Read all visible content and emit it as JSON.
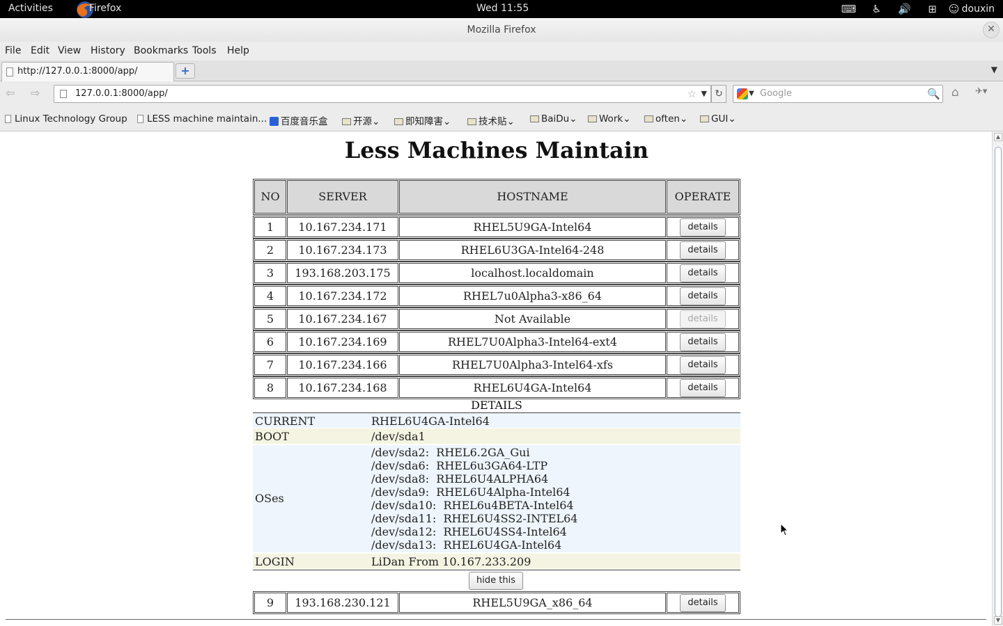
{
  "topbar": {
    "activities": "Activities",
    "app": "Firefox",
    "clock": "Wed 11:55",
    "user": "douxin"
  },
  "window": {
    "title": "Mozilla Firefox"
  },
  "menu": [
    "File",
    "Edit",
    "View",
    "History",
    "Bookmarks",
    "Tools",
    "Help"
  ],
  "tab": {
    "label": "http://127.0.0.1:8000/app/"
  },
  "nav": {
    "url": "127.0.0.1:8000/app/",
    "search_placeholder": "Google"
  },
  "bookmarks": [
    "Linux Technology Group",
    "LESS machine maintain...",
    "百度音乐盒",
    "开源",
    "即知障害",
    "技术贴",
    "BaiDu",
    "Work",
    "often",
    "GUI"
  ],
  "page": {
    "title": "Less Machines Maintain",
    "headers": [
      "NO",
      "SERVER",
      "HOSTNAME",
      "OPERATE"
    ],
    "button_label": "details",
    "rows": [
      {
        "no": "1",
        "server": "10.167.234.171",
        "hostname": "RHEL5U9GA-Intel64",
        "enabled": true
      },
      {
        "no": "2",
        "server": "10.167.234.173",
        "hostname": "RHEL6U3GA-Intel64-248",
        "enabled": true
      },
      {
        "no": "3",
        "server": "193.168.203.175",
        "hostname": "localhost.localdomain",
        "enabled": true
      },
      {
        "no": "4",
        "server": "10.167.234.172",
        "hostname": "RHEL7u0Alpha3-x86_64",
        "enabled": true
      },
      {
        "no": "5",
        "server": "10.167.234.167",
        "hostname": "Not Available",
        "enabled": false
      },
      {
        "no": "6",
        "server": "10.167.234.169",
        "hostname": "RHEL7U0Alpha3-Intel64-ext4",
        "enabled": true
      },
      {
        "no": "7",
        "server": "10.167.234.166",
        "hostname": "RHEL7U0Alpha3-Intel64-xfs",
        "enabled": true
      },
      {
        "no": "8",
        "server": "10.167.234.168",
        "hostname": "RHEL6U4GA-Intel64",
        "enabled": true
      }
    ],
    "details": {
      "title": "DETAILS",
      "current_label": "CURRENT",
      "current_value": "RHEL6U4GA-Intel64",
      "boot_label": "BOOT",
      "boot_value": "/dev/sda1",
      "oses_label": "OSes",
      "oses": [
        "/dev/sda2:  RHEL6.2GA_Gui",
        "/dev/sda6:  RHEL6u3GA64-LTP",
        "/dev/sda8:  RHEL6U4ALPHA64",
        "/dev/sda9:  RHEL6U4Alpha-Intel64",
        "/dev/sda10:  RHEL6u4BETA-Intel64",
        "/dev/sda11:  RHEL6U4SS2-INTEL64",
        "/dev/sda12:  RHEL6U4SS4-Intel64",
        "/dev/sda13:  RHEL6U4GA-Intel64"
      ],
      "login_label": "LOGIN",
      "login_value": "LiDan  From  10.167.233.209",
      "hide_label": "hide this"
    },
    "last_row": {
      "no": "9",
      "server": "193.168.230.121",
      "hostname": "RHEL5U9GA_x86_64",
      "enabled": true
    }
  },
  "colors": {
    "header_bg": "#d9d9d9",
    "detail_blue": "#eef5fc",
    "detail_cream": "#f5f4e2",
    "topbar_bg": "#000000"
  }
}
